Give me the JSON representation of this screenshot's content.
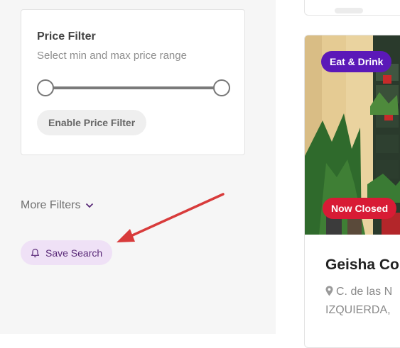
{
  "filters": {
    "price_filter": {
      "title": "Price Filter",
      "subtitle": "Select min and max price range",
      "enable_button_label": "Enable Price Filter"
    },
    "more_filters_label": "More Filters",
    "save_search_label": "Save Search"
  },
  "listing": {
    "category_badge": "Eat & Drink",
    "status_badge": "Now Closed",
    "title": "Geisha Co",
    "address_line1": "C. de las N",
    "address_line2": "IZQUIERDA, "
  },
  "icons": {
    "more_filters": "chevron-down-icon",
    "save_search": "bell-icon",
    "address": "map-pin-icon"
  },
  "colors": {
    "accent_purple": "#5b18b8",
    "status_red": "#d81b35",
    "save_search_bg": "#efe1f6",
    "annotation_arrow": "#d83b3b"
  }
}
